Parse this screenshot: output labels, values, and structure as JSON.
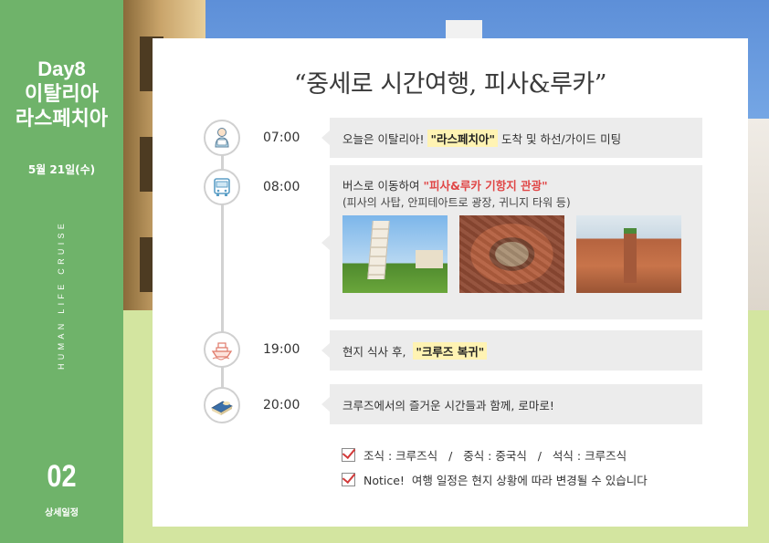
{
  "sidebar": {
    "day_line1": "Day8",
    "day_line2": "이탈리아",
    "day_line3": "라스페치아",
    "date": "5월 21일(수)",
    "vertical_text": "HUMAN LIFE CRUISE",
    "section_number": "02",
    "section_label": "상세일정"
  },
  "title": "“중세로 시간여행, 피사&루카”",
  "schedule": [
    {
      "time": "07:00",
      "icon": "guide-person-icon",
      "text_before": "오늘은 이탈리아!",
      "highlight": "\"라스페치아\"",
      "text_after": "도착 및 하선/가이드 미팅"
    },
    {
      "time": "08:00",
      "icon": "bus-icon",
      "text_before": "버스로 이동하여",
      "highlight": "\"피사&루카 기항지 관광\"",
      "line2": "(피사의 사탑, 안피테아트로 광장, 귀니지 타워 등)"
    },
    {
      "time": "19:00",
      "icon": "cruise-ship-icon",
      "text_before": "현지 식사 후,",
      "highlight": "\"크루즈 복귀\""
    },
    {
      "time": "20:00",
      "icon": "bed-icon",
      "text": "크루즈에서의 즐거운 시간들과 함께, 로마로!"
    }
  ],
  "notes": {
    "meals": "조식 : 크루즈식   /   중식 : 중국식   /   석식 : 크루즈식",
    "notice": "Notice!  여행 일정은 현지 상황에 따라 변경될 수 있습니다"
  },
  "colors": {
    "sidebar_green": "#6fb36a",
    "highlight_yellow": "#fff3b3",
    "bubble_gray": "#ececec",
    "check_red": "#d23a3a"
  }
}
